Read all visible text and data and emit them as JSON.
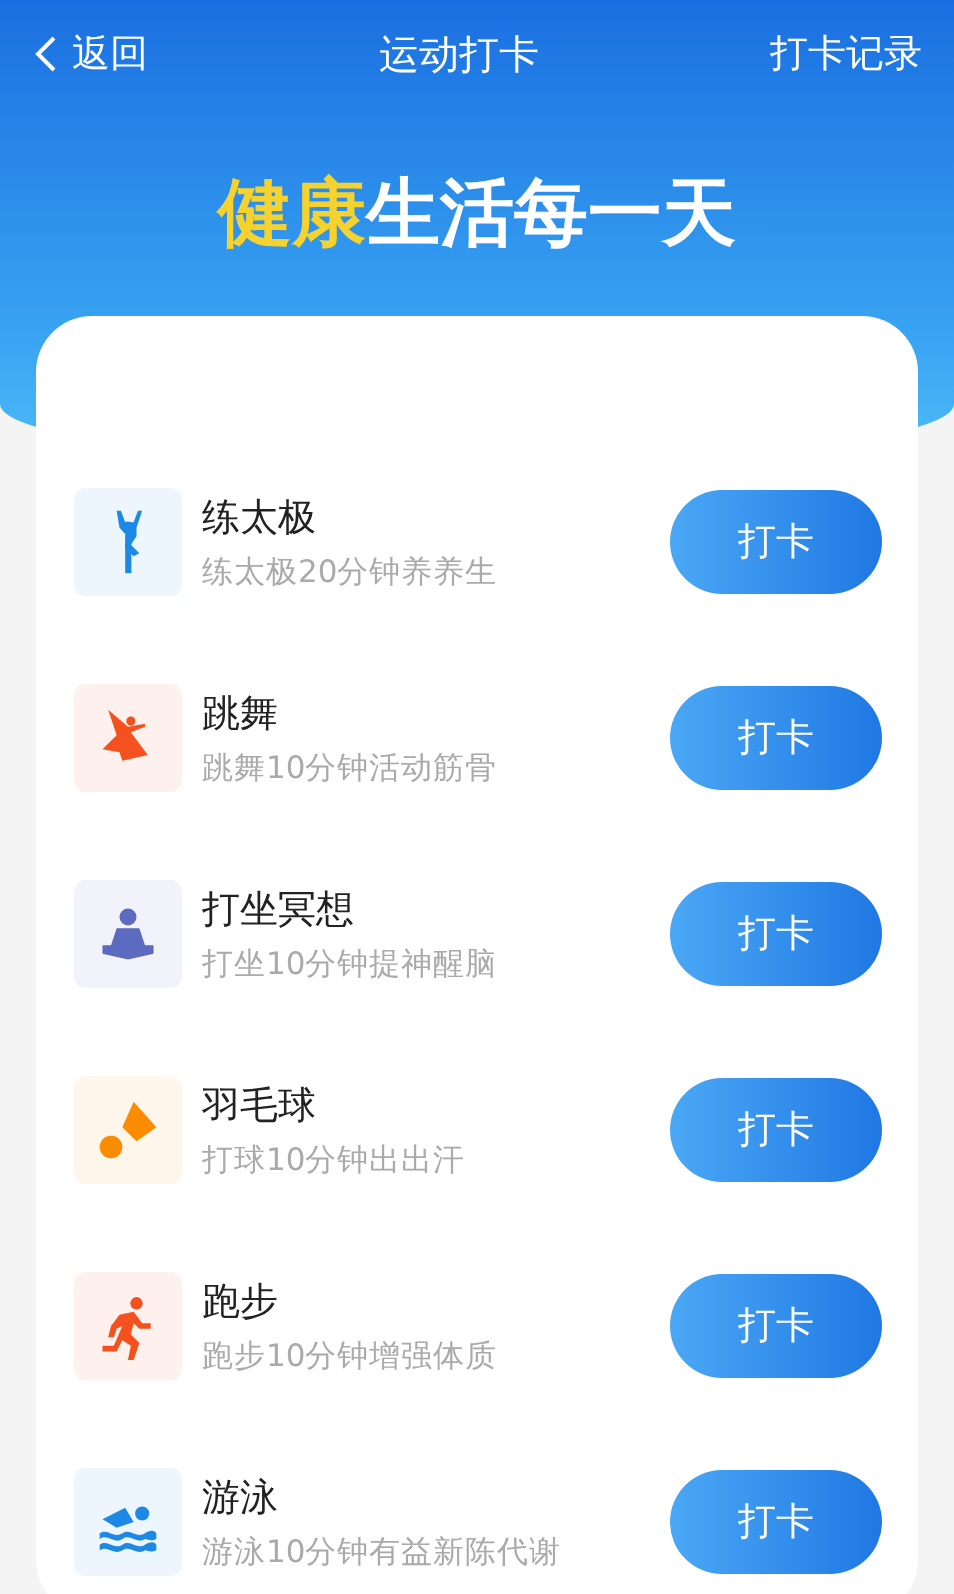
{
  "nav": {
    "back": "返回",
    "title": "运动打卡",
    "action": "打卡记录"
  },
  "banner": {
    "highlight": "健康",
    "rest": "生活每一天"
  },
  "activities": [
    {
      "kind": "yoga",
      "color": "#1e88e5",
      "title": "练太极",
      "subtitle": "练太极20分钟养养生",
      "button": "打卡"
    },
    {
      "kind": "dance",
      "color": "#f4511e",
      "title": "跳舞",
      "subtitle": "跳舞10分钟活动筋骨",
      "button": "打卡"
    },
    {
      "kind": "meditation",
      "color": "#5c6bc0",
      "title": "打坐冥想",
      "subtitle": "打坐10分钟提神醒脑",
      "button": "打卡"
    },
    {
      "kind": "badminton",
      "color": "#fb8c00",
      "title": "羽毛球",
      "subtitle": "打球10分钟出出汗",
      "button": "打卡"
    },
    {
      "kind": "running",
      "color": "#f4511e",
      "title": "跑步",
      "subtitle": "跑步10分钟增强体质",
      "button": "打卡"
    },
    {
      "kind": "swimming",
      "color": "#1e88e5",
      "title": "游泳",
      "subtitle": "游泳10分钟有益新陈代谢",
      "button": "打卡"
    }
  ]
}
